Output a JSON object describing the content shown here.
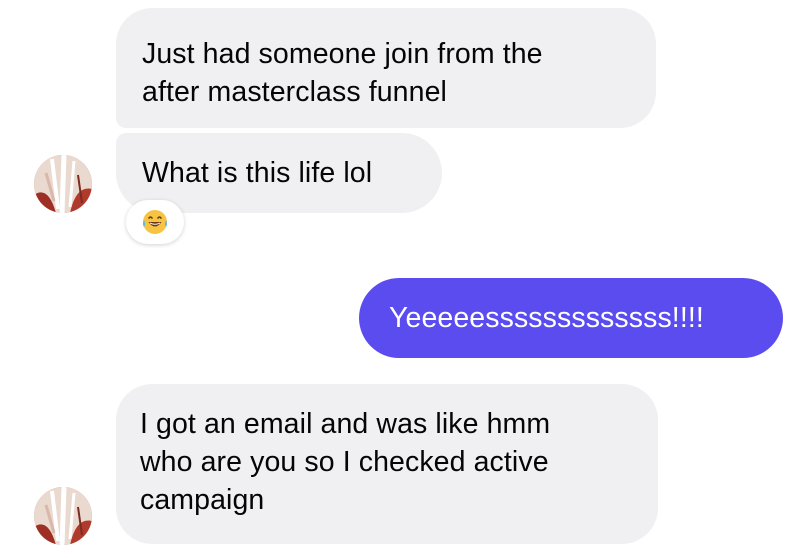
{
  "conversation": {
    "messages": [
      {
        "sender": "contact",
        "text": "Just had someone join from the\nafter masterclass funnel"
      },
      {
        "sender": "contact",
        "text": "What is this life lol"
      },
      {
        "sender": "me",
        "text": "Yeeeeesssssssssssss!!!!"
      },
      {
        "sender": "contact",
        "text": "I got an email and was like hmm\nwho are you so I checked active\ncampaign"
      }
    ],
    "reactions": [
      {
        "message_index": 1,
        "icon": "laughing-tears-emoji-icon",
        "glyph": "😂"
      }
    ]
  },
  "colors": {
    "incoming_bubble": "#f0f0f3",
    "outgoing_bubble": "#5b4cf0",
    "incoming_text": "#050505",
    "outgoing_text": "#ffffff"
  }
}
